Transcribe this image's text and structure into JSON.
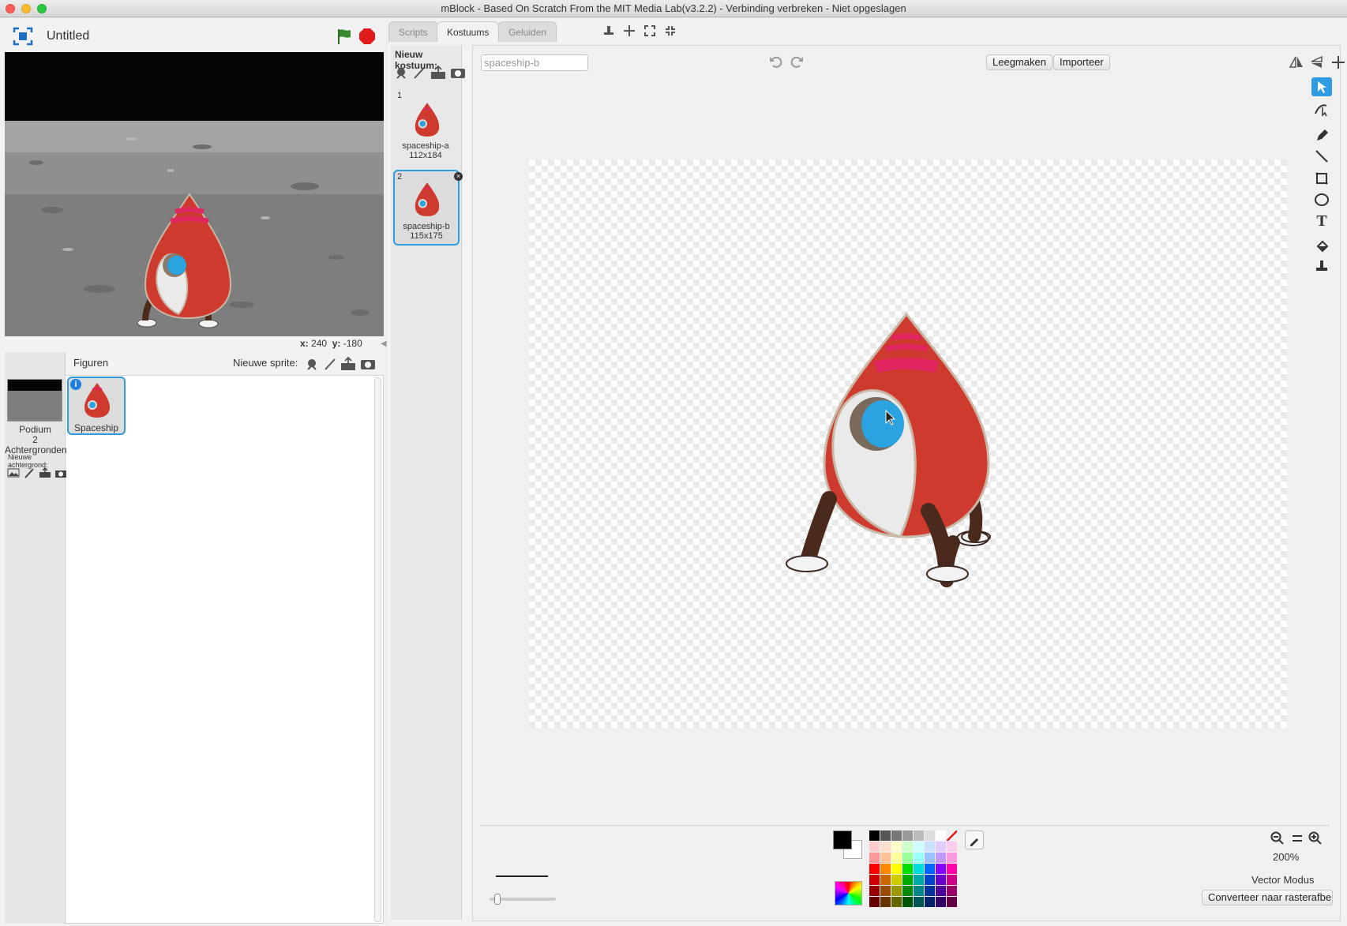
{
  "window": {
    "title": "mBlock - Based On Scratch From the MIT Media Lab(v3.2.2) - Verbinding verbreken - Niet opgeslagen"
  },
  "stage": {
    "title": "Untitled",
    "x_label": "x:",
    "x_value": "240",
    "y_label": "y:",
    "y_value": "-180"
  },
  "sprites": {
    "header": "Figuren",
    "new_sprite_label": "Nieuwe sprite:",
    "stage_item": {
      "name": "Podium",
      "sub": "2 Achtergronden"
    },
    "new_backdrop_label": "Nieuwe achtergrond:",
    "items": [
      {
        "name": "Spaceship"
      }
    ]
  },
  "tabs": [
    {
      "label": "Scripts"
    },
    {
      "label": "Kostuums"
    },
    {
      "label": "Geluiden"
    }
  ],
  "costumes": {
    "new_label": "Nieuw kostuum:",
    "items": [
      {
        "index": "1",
        "name": "spaceship-a",
        "size": "112x184"
      },
      {
        "index": "2",
        "name": "spaceship-b",
        "size": "115x175"
      }
    ]
  },
  "paint": {
    "name_value": "spaceship-b",
    "clear_label": "Leegmaken",
    "import_label": "Importeer",
    "zoom": "200%",
    "mode": "Vector Modus",
    "convert_label": "Converteer naar rasterafbe"
  },
  "colors": {
    "accent": "#2f9be0",
    "flag": "#3a8a2f",
    "stop": "#e01b1b",
    "rocket_red": "#cf3a2e",
    "rocket_pink": "#e0245e",
    "window_blue": "#2aa3e0"
  }
}
